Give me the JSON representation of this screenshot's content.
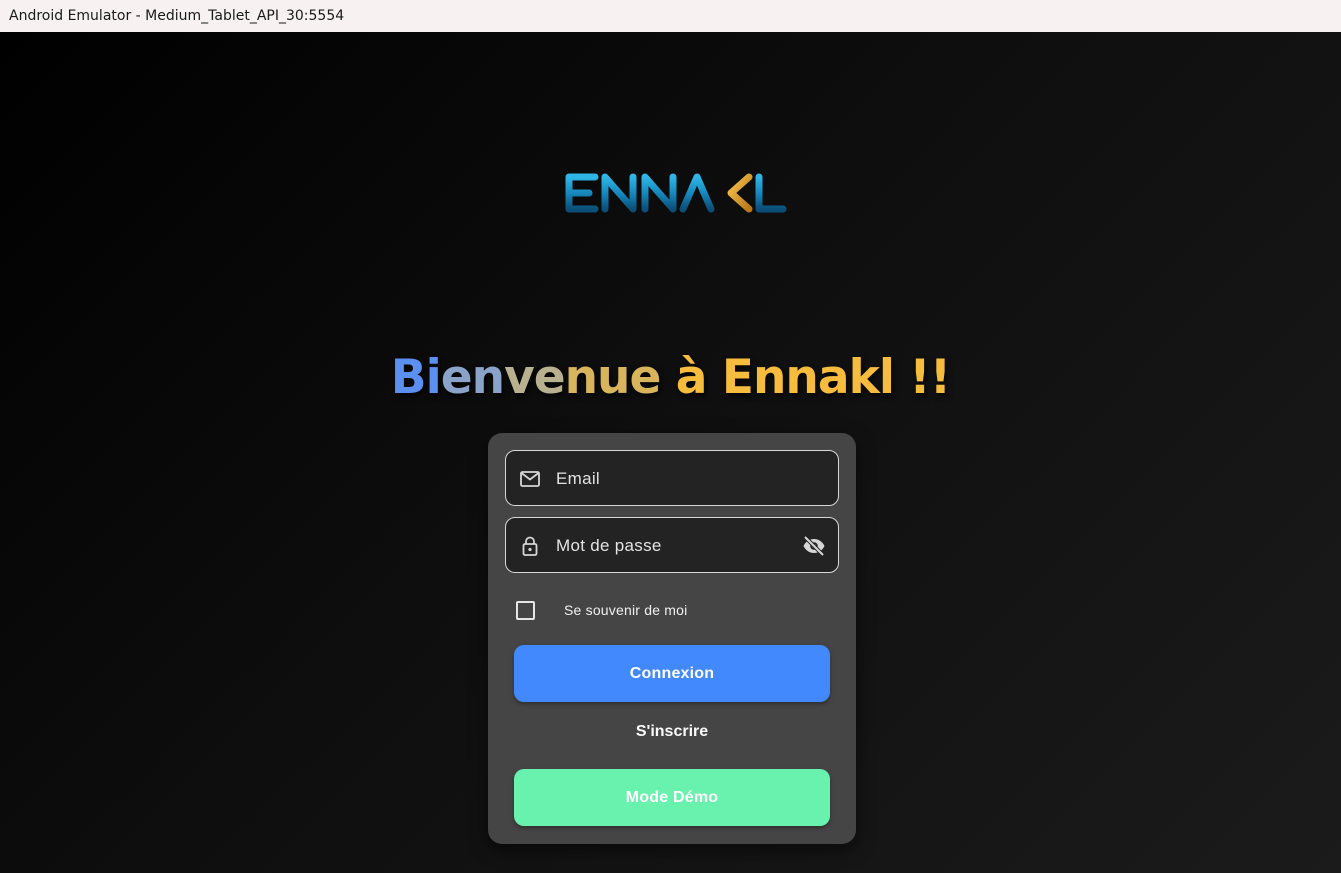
{
  "window": {
    "title": "Android Emulator - Medium_Tablet_API_30:5554"
  },
  "logo": {
    "text": "ENNAKL"
  },
  "welcome": {
    "segments": [
      {
        "text": "Bi",
        "color": "#5b8ff0"
      },
      {
        "text": "en",
        "color": "#8aa3c9"
      },
      {
        "text": "ve",
        "color": "#b8b08f"
      },
      {
        "text": "nue",
        "color": "#d8b45c"
      },
      {
        "text": " à Ennakl !!",
        "color": "#f6bc3d"
      }
    ]
  },
  "form": {
    "email_label": "Email",
    "password_label": "Mot de passe",
    "remember_label": "Se souvenir de moi",
    "remember_checked": false,
    "login_label": "Connexion",
    "signup_label": "S'inscrire",
    "demo_label": "Mode Démo"
  },
  "icons": {
    "email": "mail-icon",
    "password": "lock-icon",
    "visibility": "visibility-off-icon"
  },
  "colors": {
    "login_button": "#4289fd",
    "demo_button": "#69f1ae",
    "card": "#454545"
  }
}
